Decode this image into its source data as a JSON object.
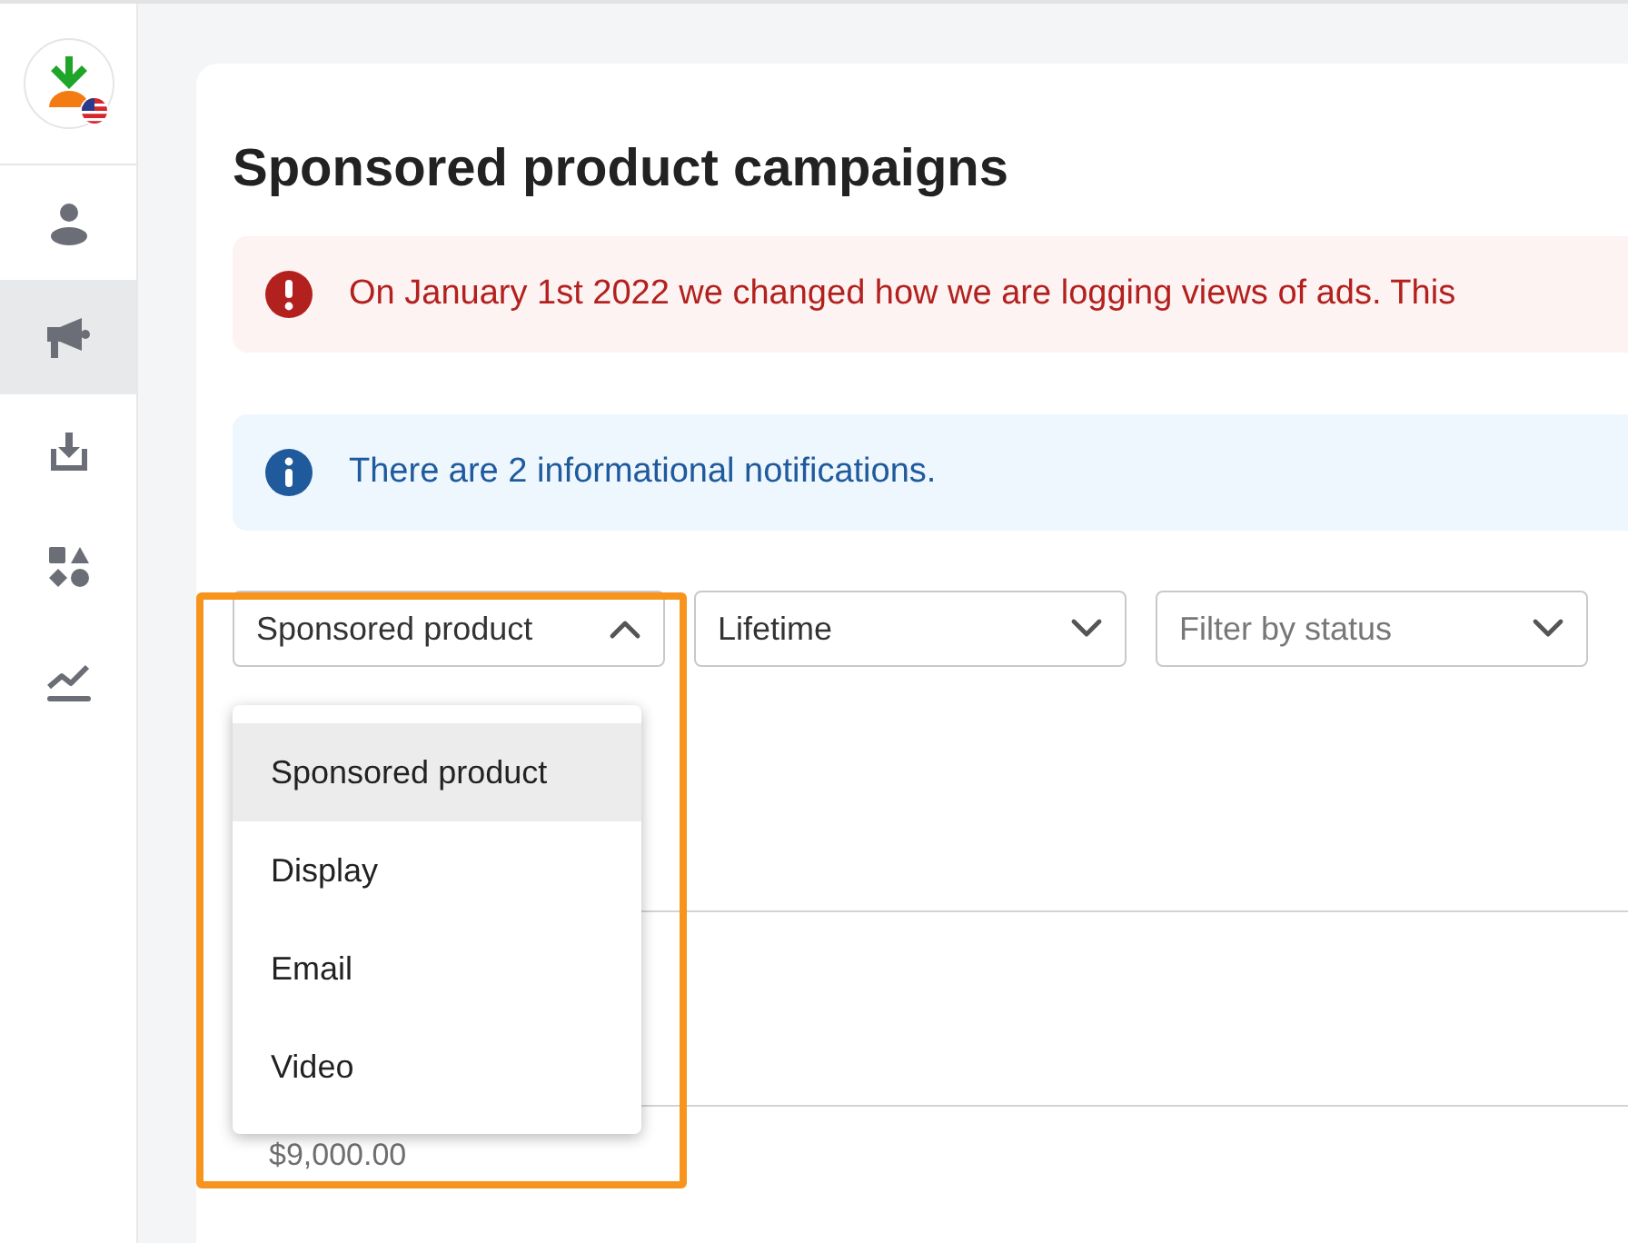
{
  "sidebar": {
    "items": [
      {
        "selected": false
      },
      {
        "selected": true
      },
      {
        "selected": false
      },
      {
        "selected": false
      },
      {
        "selected": false
      }
    ]
  },
  "title": "Sponsored product campaigns",
  "alerts": [
    {
      "kind": "error",
      "text": "On January 1st 2022 we changed how we are logging views of ads. This"
    },
    {
      "kind": "info",
      "text": "There are 2 informational notifications."
    }
  ],
  "filters": [
    {
      "value": "Sponsored product",
      "expanded": true
    },
    {
      "value": "Lifetime",
      "expanded": false
    },
    {
      "placeholder": "Filter by status",
      "expanded": false
    }
  ],
  "dropdown": {
    "options": [
      {
        "label": "Sponsored product",
        "selected": true
      },
      {
        "label": "Display",
        "selected": false
      },
      {
        "label": "Email",
        "selected": false
      },
      {
        "label": "Video",
        "selected": false
      }
    ]
  },
  "amount": "$9,000.00"
}
